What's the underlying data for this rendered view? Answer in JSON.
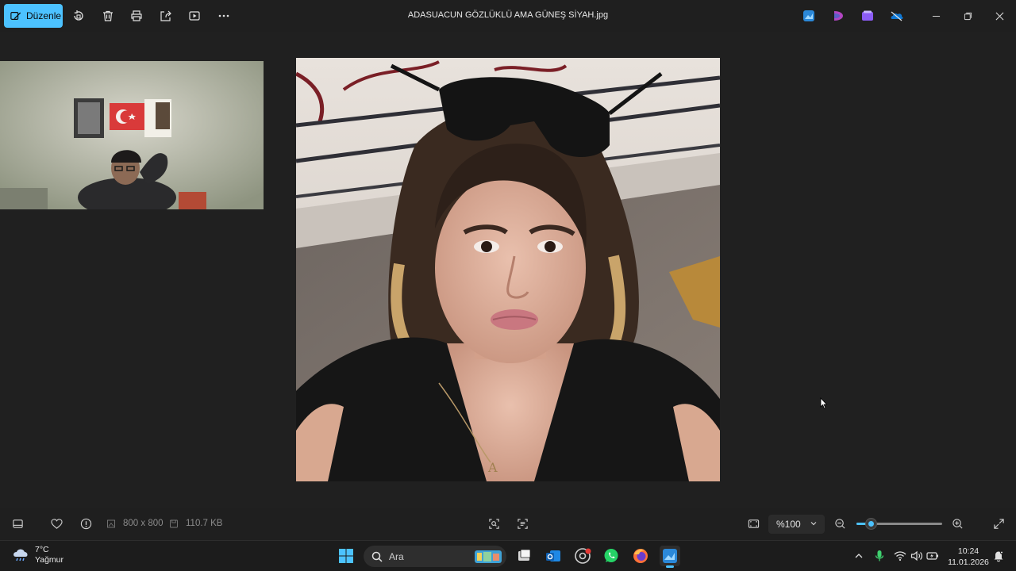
{
  "toolbar": {
    "edit_label": "Düzenle",
    "icons": [
      "rotate-icon",
      "delete-icon",
      "print-icon",
      "share-icon",
      "slideshow-icon",
      "more-icon"
    ]
  },
  "window": {
    "title": "ADASUACUN GÖZLÜKLÜ AMA GÜNEŞ SİYAH.jpg"
  },
  "statusbar": {
    "dimensions": "800 x 800",
    "filesize": "110.7 KB",
    "zoom": "%100",
    "zoom_fraction": 0.17
  },
  "taskbar": {
    "weather_temp": "7°C",
    "weather_desc": "Yağmur",
    "search_placeholder": "Ara",
    "time": "10:24",
    "date": "11.01.2026"
  },
  "colors": {
    "accent": "#4cc2ff",
    "background": "#1f1f1f"
  }
}
